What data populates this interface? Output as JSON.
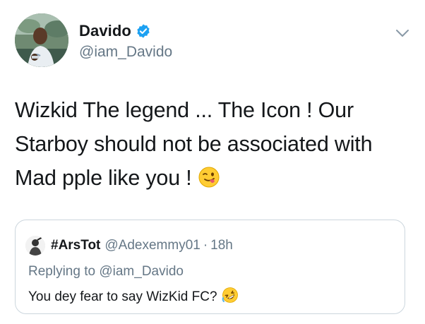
{
  "author": {
    "display_name": "Davido",
    "handle": "@iam_Davido",
    "verified": true,
    "verified_color": "#1da1f2"
  },
  "icons": {
    "caret": "chevron-down-icon",
    "verified": "verified-badge-icon",
    "tweet_emoji": "smirk-tongue-emoji",
    "quote_emoji": "rolling-laughing-emoji"
  },
  "tweet": {
    "line1": "Wizkid The legend ... The Icon ! Our",
    "line2": "Starboy should not be associated with",
    "line3": "Mad pple like you !"
  },
  "quoted": {
    "display_name": "#ArsTot",
    "handle": "@Adexemmy01",
    "separator": "·",
    "time": "18h",
    "replying_prefix": "Replying to",
    "replying_handle": "@iam_Davido",
    "text": "You dey fear to say WizKid FC?"
  },
  "colors": {
    "text": "#14171a",
    "secondary": "#657786",
    "border": "#ccd6dd",
    "accent": "#1da1f2"
  }
}
